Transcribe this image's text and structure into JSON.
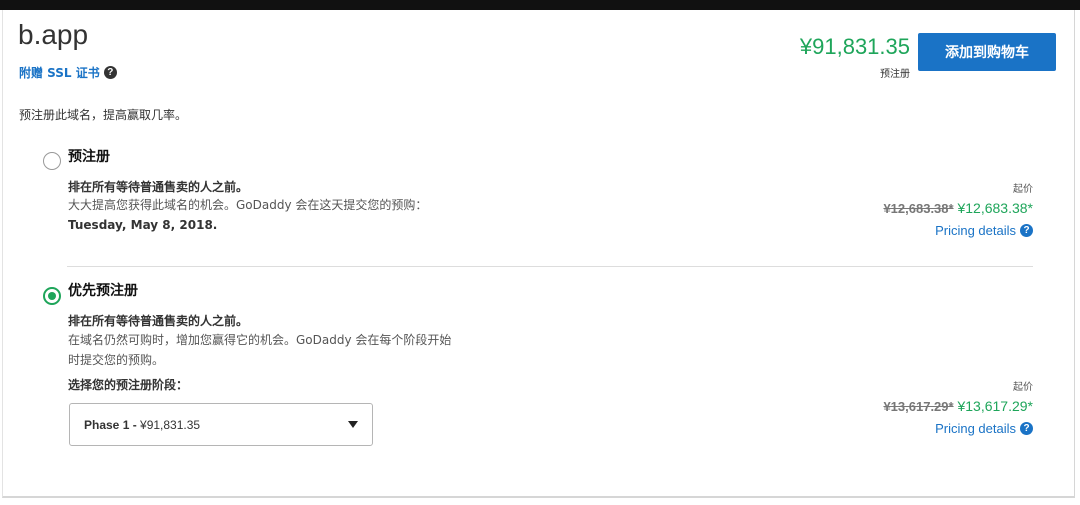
{
  "header": {
    "domain": "b.app",
    "ssl_text": "附赠 SSL 证书",
    "price": "¥91,831.35",
    "price_label": "预注册",
    "add_to_cart": "添加到购物车"
  },
  "intro": "预注册此域名，提高赢取几率。",
  "options": [
    {
      "title": "预注册",
      "selected": false,
      "bold_line": "排在所有等待普通售卖的人之前。",
      "desc_lines": [
        "大大提高您获得此域名的机会。GoDaddy 会在这天提交您的预购：",
        "Tuesday, May 8, 2018."
      ],
      "start_label": "起价",
      "old_price": "¥12,683.38*",
      "new_price": "¥12,683.38*",
      "pricing_details": "Pricing details"
    },
    {
      "title": "优先预注册",
      "selected": true,
      "bold_line": "排在所有等待普通售卖的人之前。",
      "desc_lines": [
        "在域名仍然可购时，增加您赢得它的机会。GoDaddy 会在每个阶段开始",
        "时提交您的预购。"
      ],
      "phase_label": "选择您的预注册阶段：",
      "phase_select": {
        "prefix": "Phase 1 - ",
        "value": "¥91,831.35"
      },
      "start_label": "起价",
      "old_price": "¥13,617.29*",
      "new_price": "¥13,617.29*",
      "pricing_details": "Pricing details"
    }
  ],
  "icons": {
    "help": "question-circle-icon",
    "caret": "caret-down-icon"
  },
  "colors": {
    "accent": "#1a73c6",
    "price_green": "#1ea55a"
  }
}
